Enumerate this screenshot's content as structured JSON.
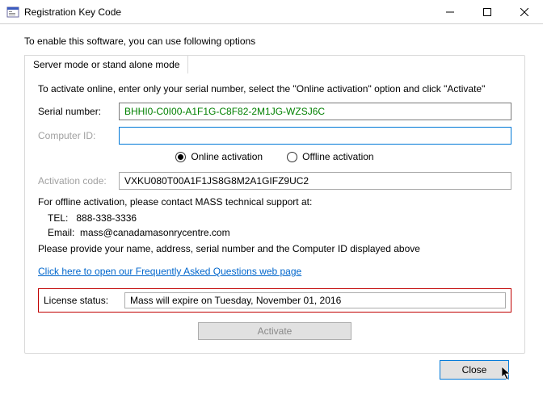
{
  "window": {
    "title": "Registration Key Code"
  },
  "intro": "To enable this software, you can use following options",
  "tab": {
    "label": "Server mode or stand alone mode"
  },
  "instruction": "To activate online, enter only your serial number, select the \"Online activation\" option and click \"Activate\"",
  "serial": {
    "label": "Serial number:",
    "value": "BHHI0-C0I00-A1F1G-C8F82-2M1JG-WZSJ6C"
  },
  "computer_id": {
    "label": "Computer ID:",
    "value": ""
  },
  "activation_mode": {
    "online_label": "Online activation",
    "offline_label": "Offline activation",
    "selected": "online"
  },
  "activation_code": {
    "label": "Activation code:",
    "value": "VXKU080T00A1F1JS8G8M2A1GIFZ9UC2"
  },
  "support": {
    "lead": "For offline activation, please contact MASS technical support at:",
    "tel_label": "TEL:",
    "tel": "888-338-3336",
    "email_label": "Email:",
    "email": "mass@canadamasonrycentre.com",
    "provide": "Please provide your name, address, serial number and the Computer ID displayed above"
  },
  "faq_link": "Click here to open our Frequently Asked Questions web page",
  "license": {
    "label": "License status:",
    "value": "Mass will expire on Tuesday, November 01, 2016"
  },
  "buttons": {
    "activate": "Activate",
    "close": "Close"
  }
}
